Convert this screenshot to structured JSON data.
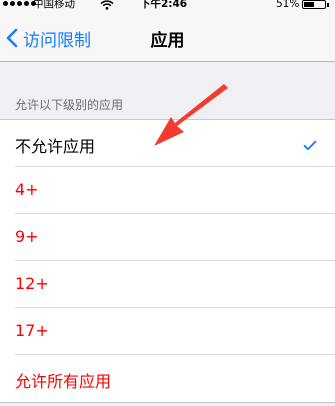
{
  "status_bar": {
    "carrier": "中国移动",
    "time": "下午2:46",
    "battery_percent": "51%",
    "battery_level": 0.51,
    "wifi_icon": "wifi-icon"
  },
  "nav": {
    "back_label": "访问限制",
    "title": "应用"
  },
  "section": {
    "header": "允许以下级别的应用"
  },
  "items": [
    {
      "label": "不允许应用",
      "checked": true
    },
    {
      "label": "4+",
      "checked": false
    },
    {
      "label": "9+",
      "checked": false
    },
    {
      "label": "12+",
      "checked": false
    },
    {
      "label": "17+",
      "checked": false
    },
    {
      "label": "允许所有应用",
      "checked": false
    }
  ],
  "colors": {
    "accent_blue": "#147efb",
    "item_red": "#ff0000",
    "annotation_arrow": "#f23c2e"
  }
}
